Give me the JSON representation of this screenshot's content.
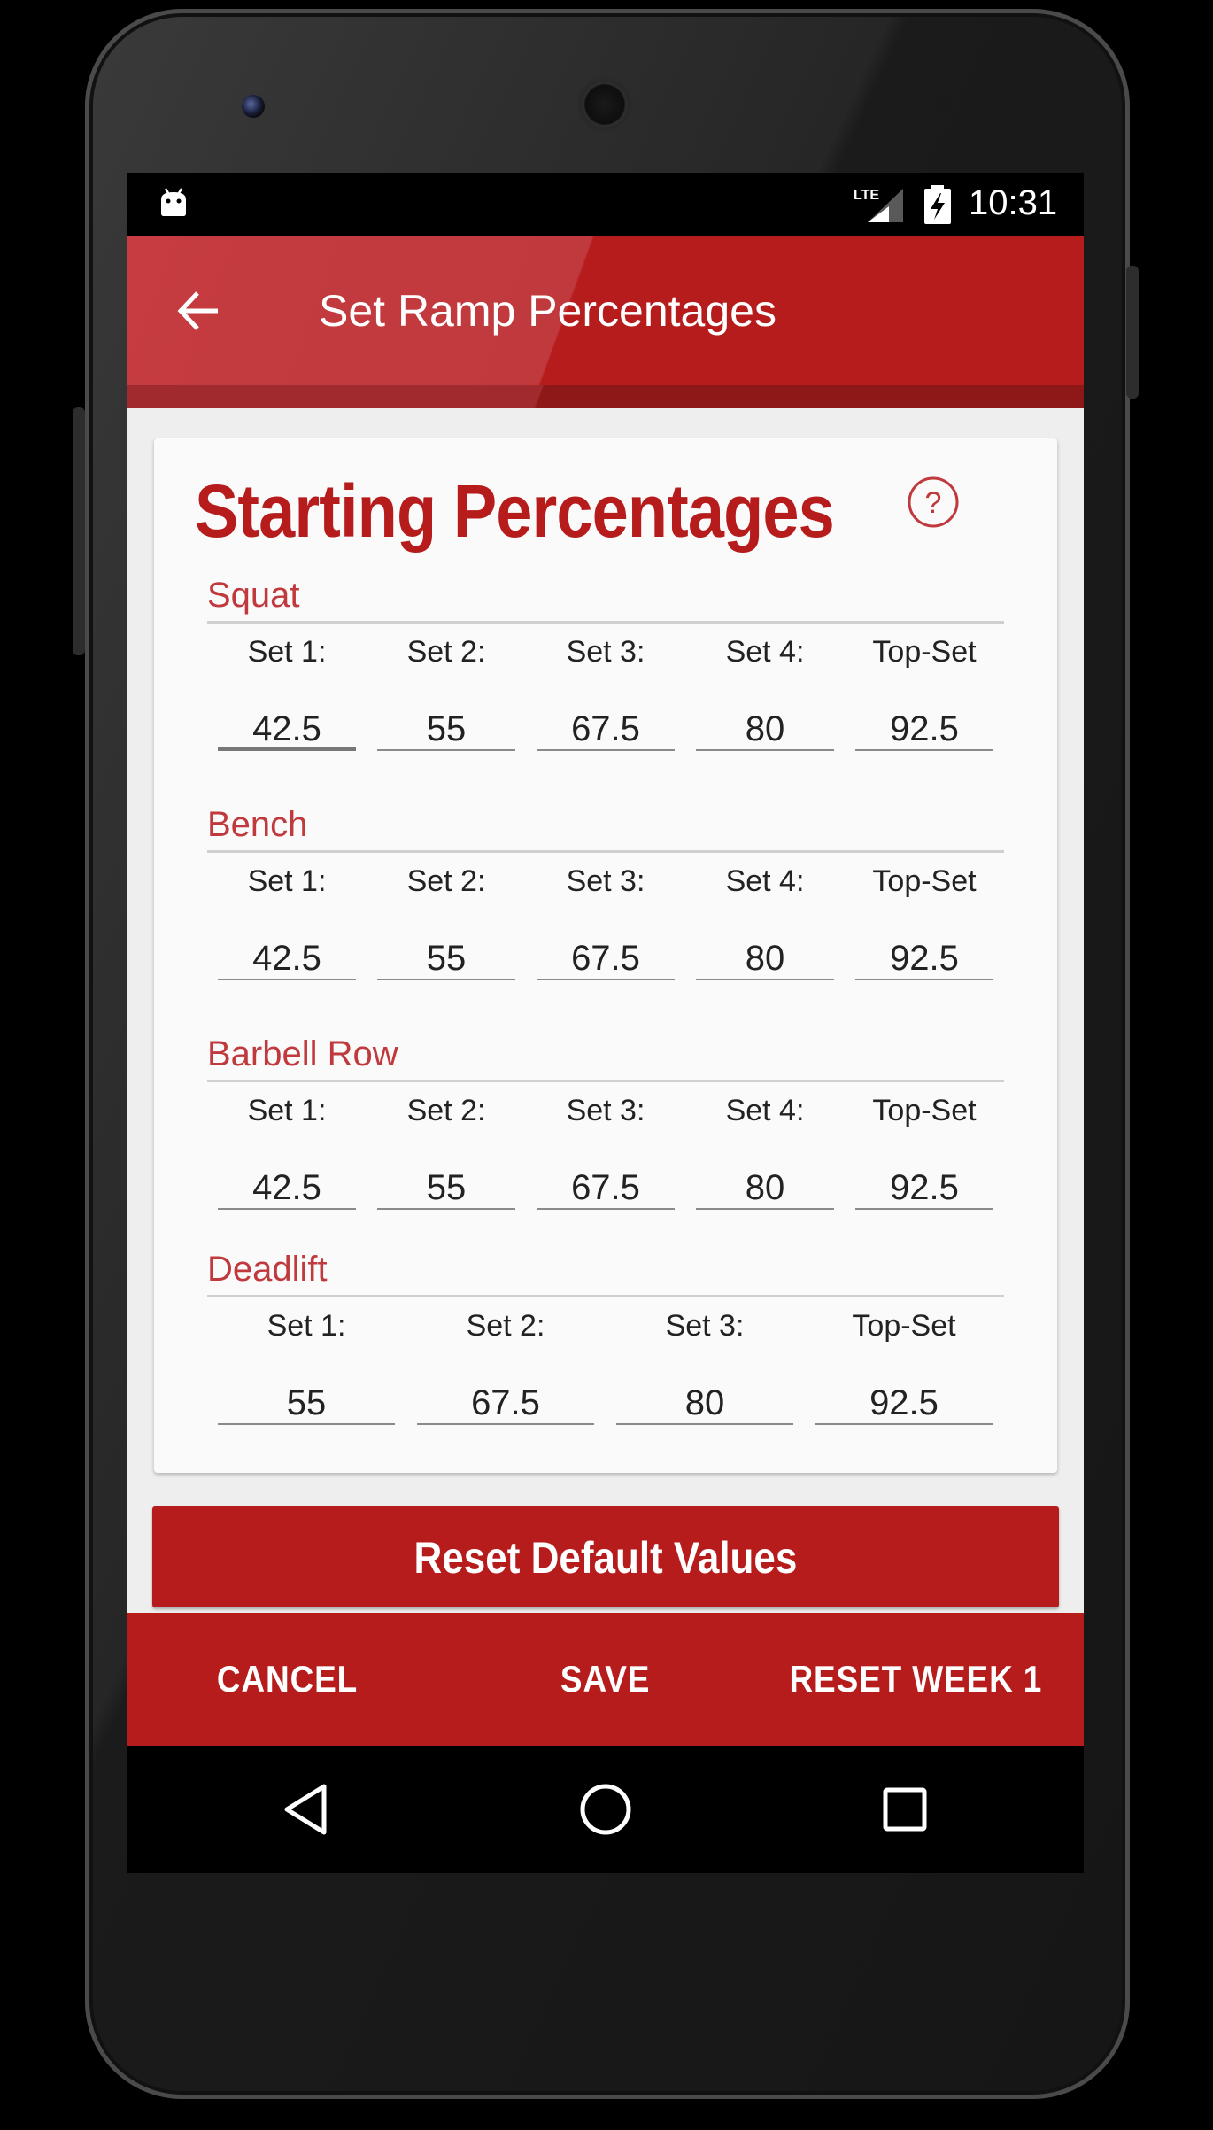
{
  "status_bar": {
    "network": "LTE",
    "time": "10:31",
    "icons": [
      "android-debug-icon",
      "lte-signal-icon",
      "battery-charging-icon"
    ]
  },
  "app_bar": {
    "title": "Set Ramp Percentages",
    "back_icon": "arrow-left-icon"
  },
  "card": {
    "title": "Starting Percentages",
    "help_icon": "question-circle-icon",
    "exercises": [
      {
        "name": "Squat",
        "sets": [
          {
            "label": "Set 1:",
            "value": "42.5"
          },
          {
            "label": "Set 2:",
            "value": "55"
          },
          {
            "label": "Set 3:",
            "value": "67.5"
          },
          {
            "label": "Set 4:",
            "value": "80"
          },
          {
            "label": "Top-Set",
            "value": "92.5"
          }
        ]
      },
      {
        "name": "Bench",
        "sets": [
          {
            "label": "Set 1:",
            "value": "42.5"
          },
          {
            "label": "Set 2:",
            "value": "55"
          },
          {
            "label": "Set 3:",
            "value": "67.5"
          },
          {
            "label": "Set 4:",
            "value": "80"
          },
          {
            "label": "Top-Set",
            "value": "92.5"
          }
        ]
      },
      {
        "name": "Barbell Row",
        "sets": [
          {
            "label": "Set 1:",
            "value": "42.5"
          },
          {
            "label": "Set 2:",
            "value": "55"
          },
          {
            "label": "Set 3:",
            "value": "67.5"
          },
          {
            "label": "Set 4:",
            "value": "80"
          },
          {
            "label": "Top-Set",
            "value": "92.5"
          }
        ]
      },
      {
        "name": "Deadlift",
        "sets": [
          {
            "label": "Set 1:",
            "value": "55"
          },
          {
            "label": "Set 2:",
            "value": "67.5"
          },
          {
            "label": "Set 3:",
            "value": "80"
          },
          {
            "label": "Top-Set",
            "value": "92.5"
          }
        ]
      }
    ]
  },
  "reset_defaults_label": "Reset Default Values",
  "actions": {
    "cancel": "CANCEL",
    "save": "SAVE",
    "reset_week": "RESET WEEK 1"
  },
  "nav_bar": {
    "icons": [
      "back-triangle-icon",
      "home-circle-icon",
      "recents-square-icon"
    ]
  },
  "colors": {
    "primary": "#b71c1c",
    "accent_text": "#c0393d",
    "card_bg": "#fafafa",
    "screen_bg": "#eeeeee"
  }
}
